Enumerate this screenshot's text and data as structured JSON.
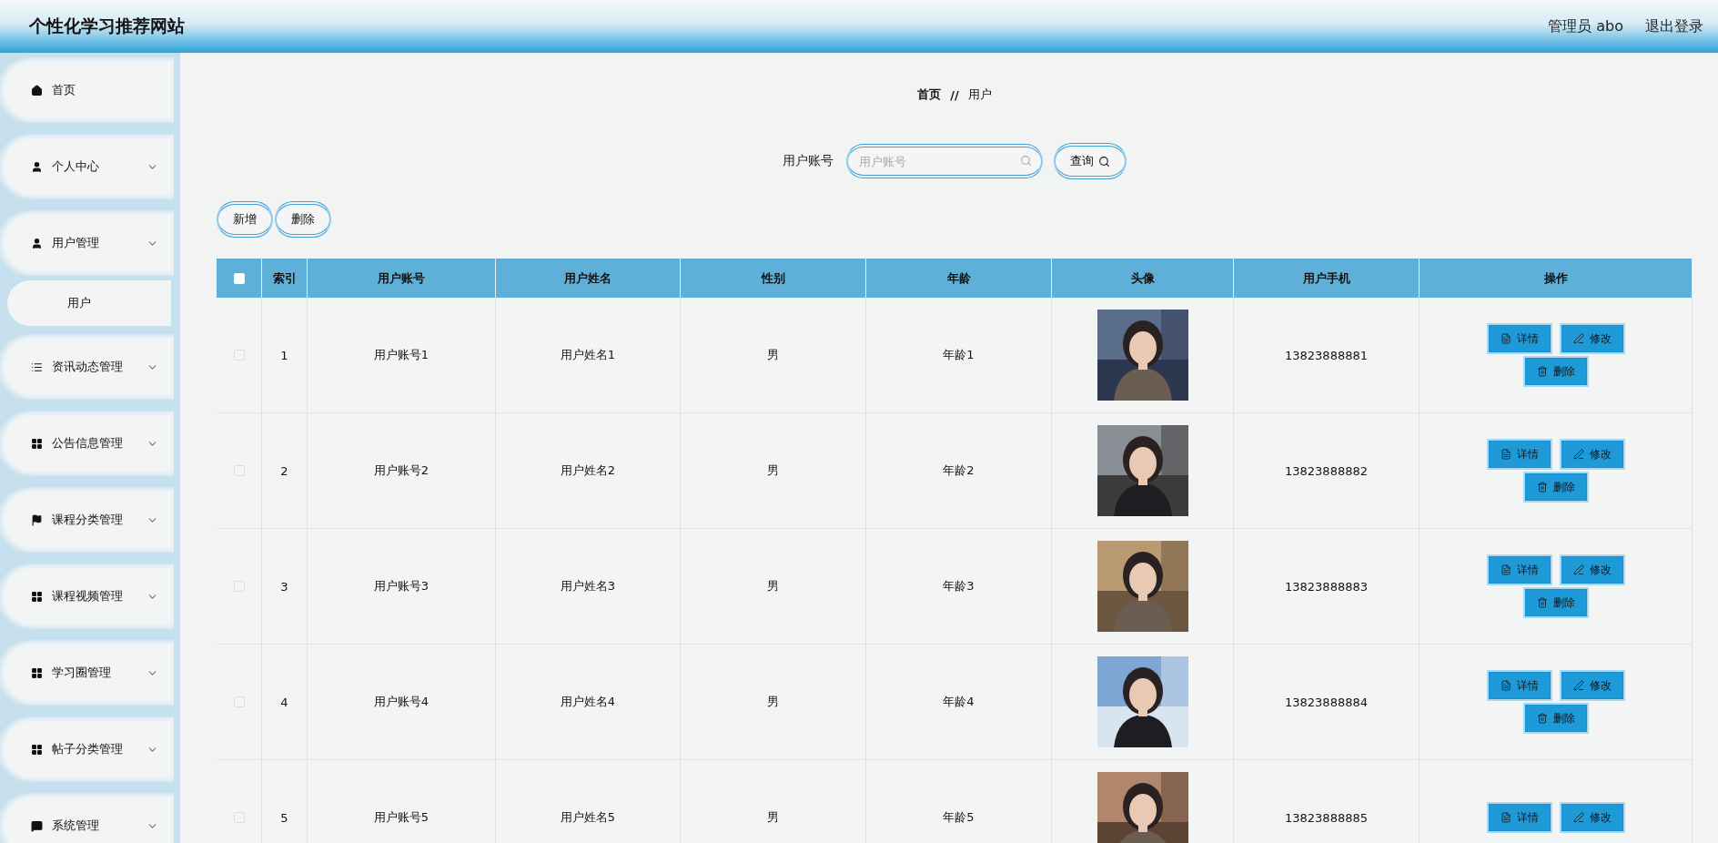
{
  "header": {
    "title": "个性化学习推荐网站",
    "user": "管理员 abo",
    "logout": "退出登录"
  },
  "sidebar": {
    "items": [
      {
        "label": "首页",
        "kind": "link"
      },
      {
        "label": "个人中心",
        "kind": "menu"
      },
      {
        "label": "用户管理",
        "kind": "menu",
        "children": [
          {
            "label": "用户",
            "selected": true
          }
        ]
      },
      {
        "label": "资讯动态管理",
        "kind": "menu"
      },
      {
        "label": "公告信息管理",
        "kind": "menu"
      },
      {
        "label": "课程分类管理",
        "kind": "menu"
      },
      {
        "label": "课程视频管理",
        "kind": "menu"
      },
      {
        "label": "学习圈管理",
        "kind": "menu"
      },
      {
        "label": "帖子分类管理",
        "kind": "menu"
      },
      {
        "label": "系统管理",
        "kind": "menu"
      }
    ]
  },
  "breadcrumb": {
    "items": [
      "首页",
      "用户"
    ],
    "separator": "//"
  },
  "search": {
    "label": "用户账号",
    "placeholder": "用户账号",
    "button": "查询"
  },
  "actions": [
    "新增",
    "删除"
  ],
  "table": {
    "select_all": {
      "checked": false
    },
    "columns": [
      "索引",
      "用户账号",
      "用户姓名",
      "性别",
      "年龄",
      "头像",
      "用户手机",
      "操作"
    ],
    "rows": [
      {
        "checked": false,
        "index": "1",
        "account": "用户账号1",
        "name": "用户姓名1",
        "gender": "男",
        "age": "年龄1",
        "avatar": {
          "kind": "picture"
        },
        "phone": "13823888881",
        "actions": [
          "详情",
          "修改",
          "删除"
        ]
      },
      {
        "checked": false,
        "index": "2",
        "account": "用户账号2",
        "name": "用户姓名2",
        "gender": "男",
        "age": "年龄2",
        "avatar": {
          "kind": "picture"
        },
        "phone": "13823888882",
        "actions": [
          "详情",
          "修改",
          "删除"
        ]
      },
      {
        "checked": false,
        "index": "3",
        "account": "用户账号3",
        "name": "用户姓名3",
        "gender": "男",
        "age": "年龄3",
        "avatar": {
          "kind": "picture"
        },
        "phone": "13823888883",
        "actions": [
          "详情",
          "修改",
          "删除"
        ]
      },
      {
        "checked": false,
        "index": "4",
        "account": "用户账号4",
        "name": "用户姓名4",
        "gender": "男",
        "age": "年龄4",
        "avatar": {
          "kind": "picture"
        },
        "phone": "13823888884",
        "actions": [
          "详情",
          "修改",
          "删除"
        ]
      },
      {
        "checked": false,
        "index": "5",
        "account": "用户账号5",
        "name": "用户姓名5",
        "gender": "男",
        "age": "年龄5",
        "avatar": {
          "kind": "picture"
        },
        "phone": "13823888885",
        "actions": [
          "详情",
          "修改"
        ]
      }
    ]
  }
}
